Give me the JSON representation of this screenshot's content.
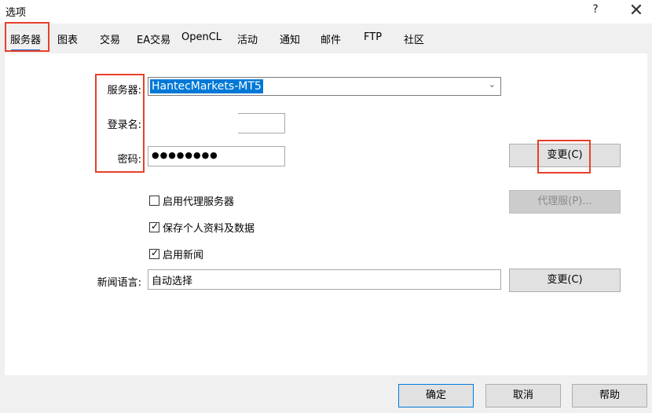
{
  "window": {
    "title": "选项",
    "help_label": "?",
    "close_label": "✕"
  },
  "tabs": [
    {
      "label": "服务器"
    },
    {
      "label": "图表"
    },
    {
      "label": "交易"
    },
    {
      "label": "EA交易"
    },
    {
      "label": "OpenCL"
    },
    {
      "label": "活动"
    },
    {
      "label": "通知"
    },
    {
      "label": "邮件"
    },
    {
      "label": "FTP"
    },
    {
      "label": "社区"
    }
  ],
  "server": {
    "server_label": "服务器:",
    "server_value": "HantecMarkets-MT5",
    "login_label": "登录名:",
    "login_value": "",
    "password_label": "密码:",
    "password_value": "●●●●●●●●",
    "change_button": "变更(C)",
    "proxy_button": "代理服(P)..."
  },
  "options": [
    {
      "label": "启用代理服务器",
      "checked": false
    },
    {
      "label": "保存个人资料及数据",
      "checked": true
    },
    {
      "label": "启用新闻",
      "checked": true
    }
  ],
  "news": {
    "language_label": "新闻语言:",
    "language_value": "自动选择",
    "change_button": "变更(C)"
  },
  "footer": {
    "ok": "确定",
    "cancel": "取消",
    "help": "帮助"
  },
  "colors": {
    "accent": "#1b6fd1",
    "highlight": "#e8402b",
    "selection": "#0078d7"
  }
}
